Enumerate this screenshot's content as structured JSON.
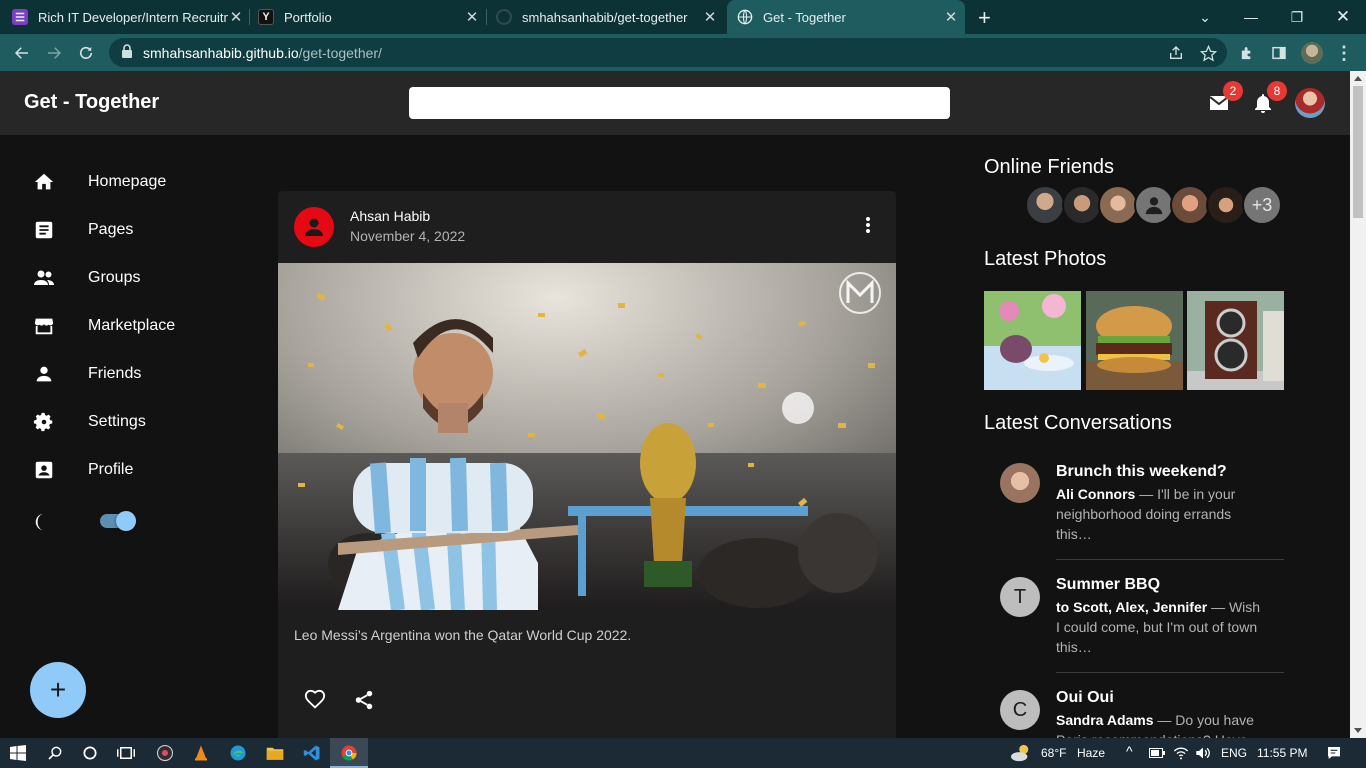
{
  "browser": {
    "tabs": [
      {
        "title": "Rich IT Developer/Intern Recruitm",
        "favicon": "form-icon",
        "color": "#7b3fc4"
      },
      {
        "title": "Portfolio",
        "favicon": "y-icon",
        "color": "#222"
      },
      {
        "title": "smhahsanhabib/get-together",
        "favicon": "github-icon",
        "color": "#333"
      },
      {
        "title": "Get - Together",
        "favicon": "globe-icon",
        "color": "#1f5c60"
      }
    ],
    "url_host": "smhahsanhabib.github.io",
    "url_path": "/get-together/"
  },
  "header": {
    "brand": "Get - Together",
    "search_placeholder": "",
    "mail_count": "2",
    "notif_count": "8"
  },
  "sidebar": {
    "items": [
      {
        "label": "Homepage",
        "icon": "home-icon"
      },
      {
        "label": "Pages",
        "icon": "article-icon"
      },
      {
        "label": "Groups",
        "icon": "group-icon"
      },
      {
        "label": "Marketplace",
        "icon": "storefront-icon"
      },
      {
        "label": "Friends",
        "icon": "person-icon"
      },
      {
        "label": "Settings",
        "icon": "gear-icon"
      },
      {
        "label": "Profile",
        "icon": "account-box-icon"
      }
    ],
    "dark_mode_on": true,
    "fab_label": "+"
  },
  "post": {
    "author": "Ahsan Habib",
    "date": "November 4, 2022",
    "caption": "Leo Messi’s Argentina won the Qatar World Cup 2022."
  },
  "right": {
    "online_title": "Online Friends",
    "online_more": "+3",
    "photos_title": "Latest Photos",
    "conv_title": "Latest Conversations",
    "conversations": [
      {
        "title": "Brunch this weekend?",
        "who": "Ali Connors",
        "text": " — I'll be in your neighborhood doing errands this…",
        "avatar": ""
      },
      {
        "title": "Summer BBQ",
        "who": "to Scott, Alex, Jennifer",
        "text": " — Wish I could come, but I'm out of town this…",
        "avatar": "T"
      },
      {
        "title": "Oui Oui",
        "who": "Sandra Adams",
        "text": " — Do you have Paris recommendations? Have…",
        "avatar": "C"
      }
    ]
  },
  "taskbar": {
    "weather": "68°F",
    "weather_desc": "Haze",
    "lang": "ENG",
    "time": "11:55 PM"
  },
  "colors": {
    "accent": "#90caf9",
    "badge": "#e53935",
    "avatar_red": "#e50914"
  }
}
